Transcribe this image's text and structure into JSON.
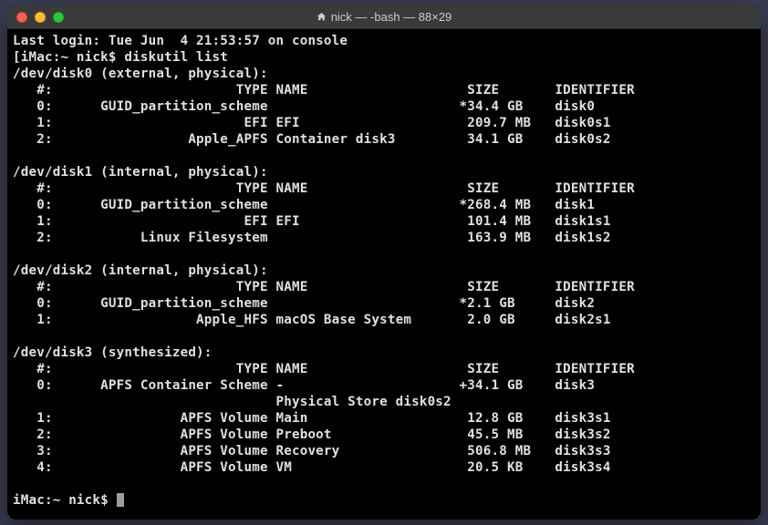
{
  "window": {
    "title": "nick — -bash — 88×29"
  },
  "terminal": {
    "last_login": "Last login: Tue Jun  4 21:53:57 on console",
    "prompt_line1": "[iMac:~ nick$ diskutil list",
    "disks": [
      {
        "header": "/dev/disk0 (external, physical):",
        "col_header": "   #:                       TYPE NAME                    SIZE       IDENTIFIER",
        "rows": [
          "   0:      GUID_partition_scheme                        *34.4 GB    disk0",
          "   1:                        EFI EFI                     209.7 MB   disk0s1",
          "   2:                 Apple_APFS Container disk3         34.1 GB    disk0s2"
        ]
      },
      {
        "header": "/dev/disk1 (internal, physical):",
        "col_header": "   #:                       TYPE NAME                    SIZE       IDENTIFIER",
        "rows": [
          "   0:      GUID_partition_scheme                        *268.4 MB   disk1",
          "   1:                        EFI EFI                     101.4 MB   disk1s1",
          "   2:           Linux Filesystem                         163.9 MB   disk1s2"
        ]
      },
      {
        "header": "/dev/disk2 (internal, physical):",
        "col_header": "   #:                       TYPE NAME                    SIZE       IDENTIFIER",
        "rows": [
          "   0:      GUID_partition_scheme                        *2.1 GB     disk2",
          "   1:                  Apple_HFS macOS Base System       2.0 GB     disk2s1"
        ]
      },
      {
        "header": "/dev/disk3 (synthesized):",
        "col_header": "   #:                       TYPE NAME                    SIZE       IDENTIFIER",
        "rows": [
          "   0:      APFS Container Scheme -                      +34.1 GB    disk3",
          "                                 Physical Store disk0s2",
          "   1:                APFS Volume Main                    12.8 GB    disk3s1",
          "   2:                APFS Volume Preboot                 45.5 MB    disk3s2",
          "   3:                APFS Volume Recovery                506.8 MB   disk3s3",
          "   4:                APFS Volume VM                      20.5 KB    disk3s4"
        ]
      }
    ],
    "prompt_end": "iMac:~ nick$ "
  }
}
